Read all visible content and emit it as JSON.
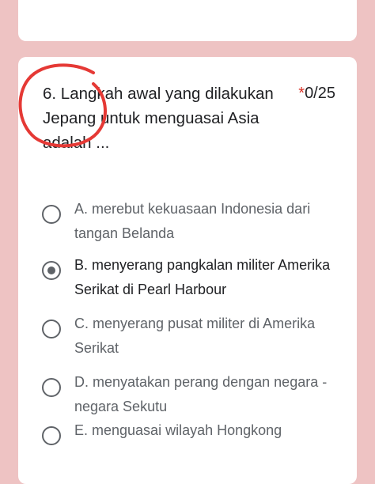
{
  "question": {
    "number_text": "6. Langkah awal yang dilakukan Jepang untuk menguasai Asia adalah ...",
    "required_mark": "*",
    "points": "0/25"
  },
  "options": [
    {
      "label": "A. merebut kekuasaan Indonesia dari tangan Belanda",
      "selected": false
    },
    {
      "label": "B. menyerang pangkalan militer Amerika Serikat di Pearl Harbour",
      "selected": true
    },
    {
      "label": "C. menyerang pusat militer di Amerika Serikat",
      "selected": false
    },
    {
      "label": "D. menyatakan perang dengan negara - negara Sekutu",
      "selected": false
    },
    {
      "label": "E. menguasai wilayah Hongkong",
      "selected": false
    }
  ],
  "colors": {
    "background": "#eec3c3",
    "card": "#ffffff",
    "annotation": "#e53935",
    "required": "#d93025"
  }
}
